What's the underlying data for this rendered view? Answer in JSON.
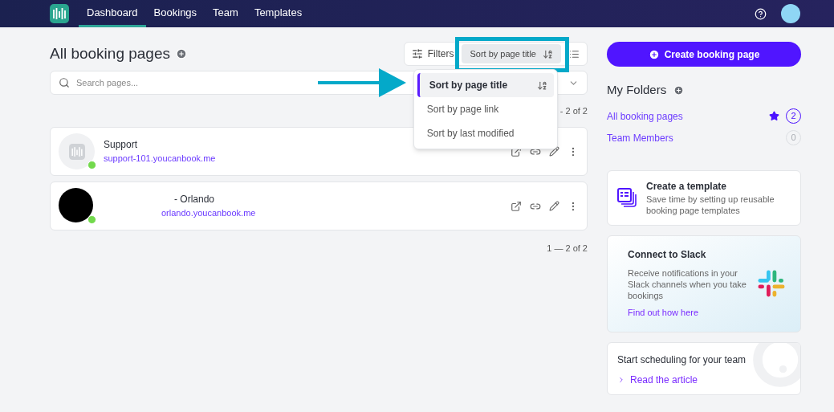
{
  "nav": {
    "tabs": [
      {
        "label": "Dashboard",
        "selected": true
      },
      {
        "label": "Bookings",
        "selected": false
      },
      {
        "label": "Team",
        "selected": false
      },
      {
        "label": "Templates",
        "selected": false
      }
    ]
  },
  "main": {
    "title": "All booking pages",
    "search": {
      "placeholder": "Search pages..."
    },
    "filters_button": "Filters",
    "sort_button": "Sort by page title",
    "sort_menu": [
      {
        "label": "Sort by page title",
        "selected": true
      },
      {
        "label": "Sort by page link",
        "selected": false
      },
      {
        "label": "Sort by last modified",
        "selected": false
      }
    ],
    "pagination_top": "- 2 of 2",
    "pages": [
      {
        "title": "Support",
        "link": "support-101.youcanbook.me",
        "kind": "logo",
        "online": true,
        "indented": false
      },
      {
        "title": "- Orlando",
        "link": "orlando.youcanbook.me",
        "kind": "blank",
        "online": true,
        "indented": true
      }
    ],
    "pagination_bottom": "1 — 2 of 2"
  },
  "sidebar": {
    "create_button": "Create booking page",
    "folders_title": "My Folders",
    "folders": [
      {
        "name": "All booking pages",
        "count": "2",
        "starred": true
      },
      {
        "name": "Team Members",
        "count": "0",
        "starred": false
      }
    ],
    "template_card": {
      "title": "Create a template",
      "description": "Save time by setting up reusable booking page templates"
    },
    "slack_card": {
      "title": "Connect to Slack",
      "description": "Receive notifications in your Slack channels when you take bookings",
      "link": "Find out how here"
    },
    "article_card": {
      "title": "Start scheduling for your team",
      "link": "Read the article"
    }
  }
}
